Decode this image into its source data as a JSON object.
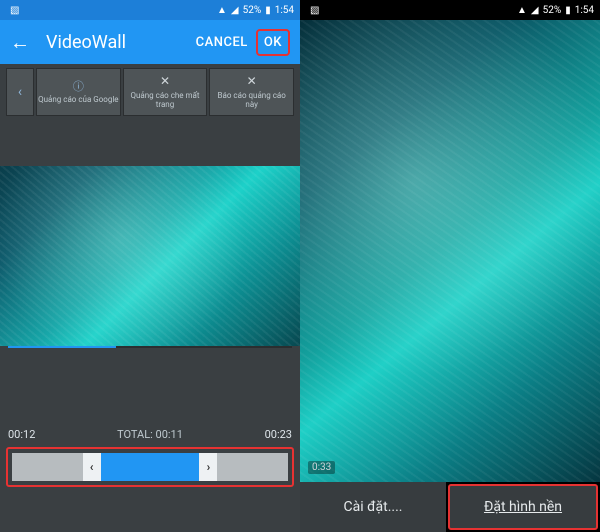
{
  "status": {
    "battery": "52%",
    "time": "1:54"
  },
  "left": {
    "title": "VideoWall",
    "cancel": "CANCEL",
    "ok": "OK",
    "ads": {
      "cell1": "Quảng cáo của Google",
      "cell2": "Quảng cáo che mất trang",
      "cell3": "Báo cáo quảng cáo này"
    },
    "time_start": "00:12",
    "time_total": "TOTAL: 00:11",
    "time_end": "00:23"
  },
  "right": {
    "overlay_time": "0:33",
    "settings": "Cài đặt....",
    "set_wallpaper": "Đặt hình nền"
  }
}
